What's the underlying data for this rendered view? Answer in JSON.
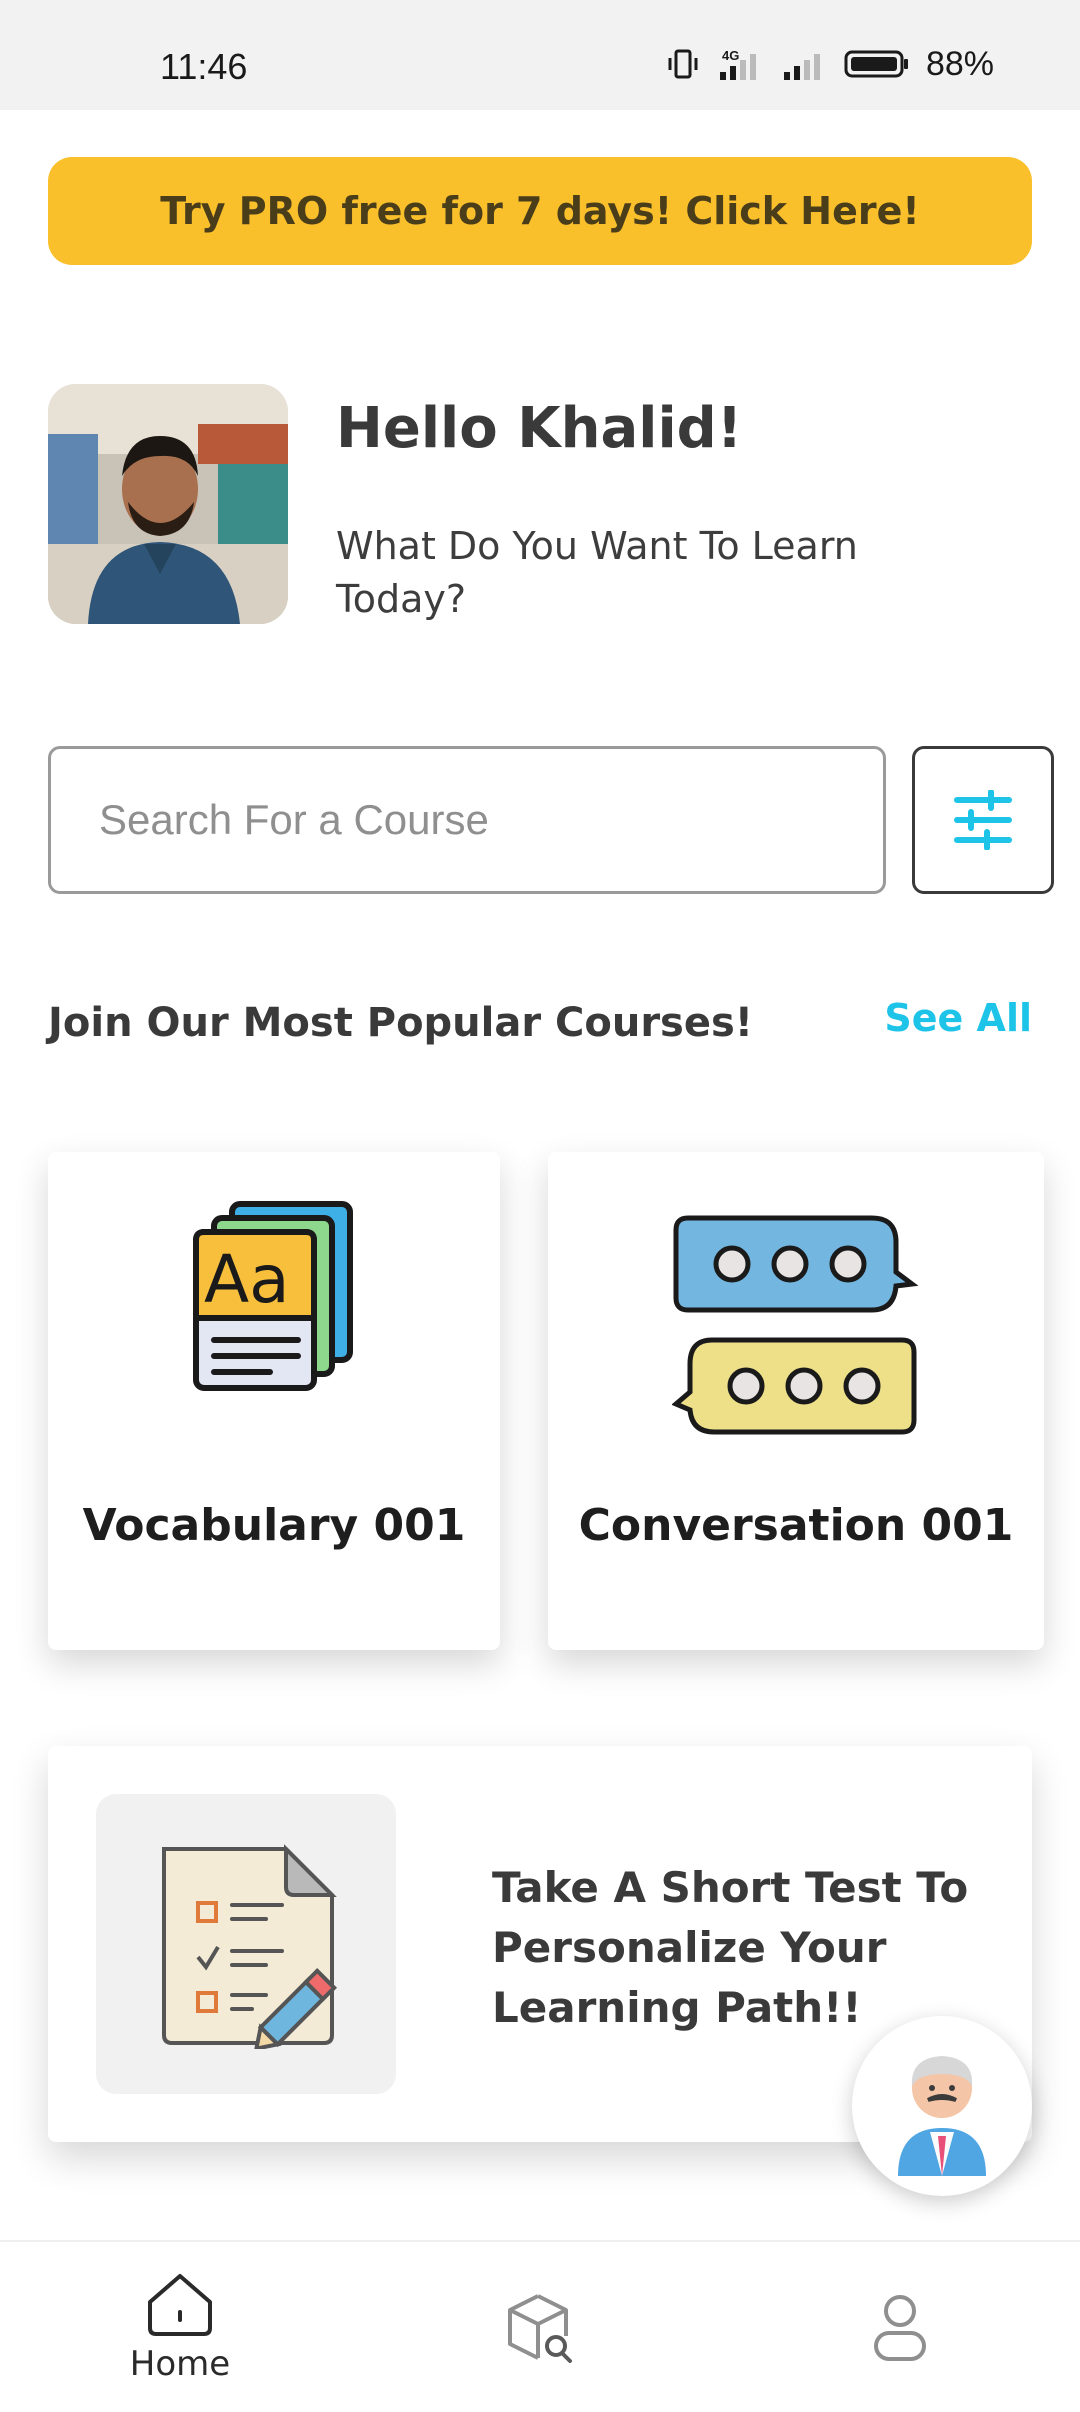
{
  "status_bar": {
    "time": "11:46",
    "battery_percent": "88%"
  },
  "promo": {
    "label": "Try PRO free for 7 days! Click Here!",
    "color": "#fac02b"
  },
  "user": {
    "greeting": "Hello Khalid!",
    "prompt": "What Do You Want To Learn Today?"
  },
  "search": {
    "placeholder": "Search For a Course"
  },
  "popular": {
    "title": "Join Our Most Popular Courses!",
    "see_all": "See All",
    "courses": [
      {
        "label": "Vocabulary 001",
        "icon": "book-icon"
      },
      {
        "label": "Conversation 001",
        "icon": "chat-bubbles-icon"
      }
    ]
  },
  "test_card": {
    "text": "Take A Short Test To Personalize Your Learning Path!!",
    "icon": "checklist-document-icon"
  },
  "nav": {
    "home_label": "Home"
  },
  "colors": {
    "accent": "#1ec3e8",
    "promo": "#fac02b"
  }
}
